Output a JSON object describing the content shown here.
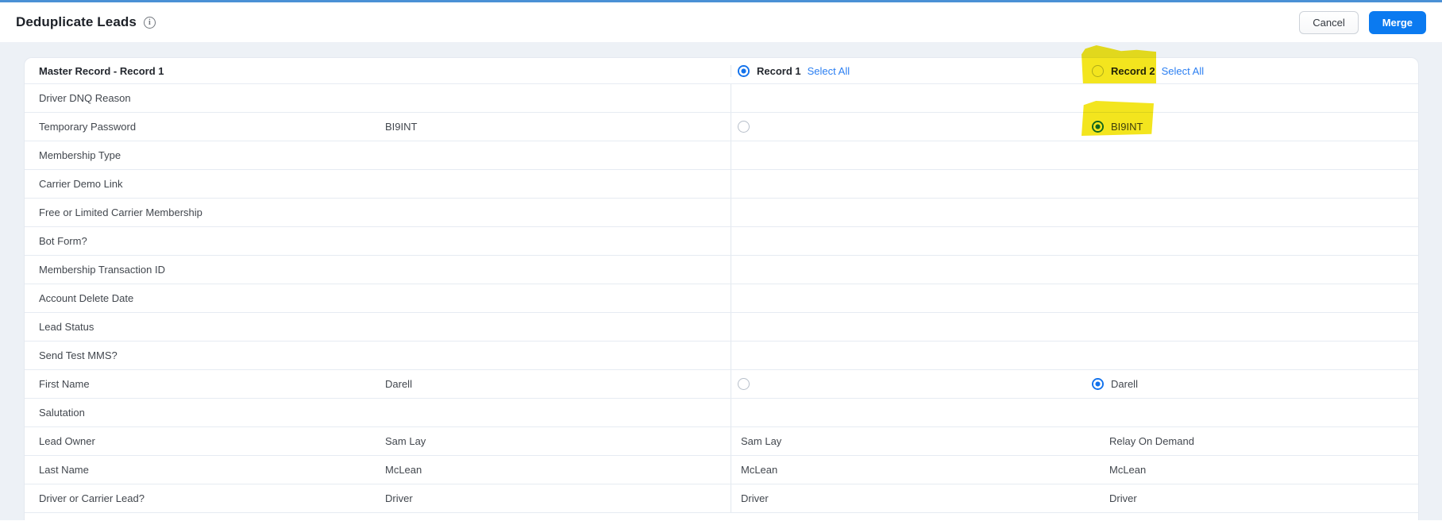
{
  "header": {
    "title": "Deduplicate Leads",
    "cancel_label": "Cancel",
    "merge_label": "Merge"
  },
  "table": {
    "master_header": "Master Record - Record 1",
    "record1_header": {
      "label": "Record 1",
      "select_all": "Select All",
      "radio": "selected"
    },
    "record2_header": {
      "label": "Record 2",
      "select_all": "Select All",
      "radio": "unselected"
    },
    "rows": [
      {
        "label": "Driver DNQ Reason",
        "master": "",
        "r1": {
          "radio": "none",
          "text": ""
        },
        "r2": {
          "radio": "none",
          "text": ""
        }
      },
      {
        "label": "Temporary Password",
        "master": "BI9INT",
        "r1": {
          "radio": "unselected",
          "text": ""
        },
        "r2": {
          "radio": "selected",
          "text": "BI9INT",
          "highlight": true
        }
      },
      {
        "label": "Membership Type",
        "master": "",
        "r1": {
          "radio": "none",
          "text": ""
        },
        "r2": {
          "radio": "none",
          "text": ""
        }
      },
      {
        "label": "Carrier Demo Link",
        "master": "",
        "r1": {
          "radio": "none",
          "text": ""
        },
        "r2": {
          "radio": "none",
          "text": ""
        }
      },
      {
        "label": "Free or Limited Carrier Membership",
        "master": "",
        "r1": {
          "radio": "none",
          "text": ""
        },
        "r2": {
          "radio": "none",
          "text": ""
        }
      },
      {
        "label": "Bot Form?",
        "master": "",
        "r1": {
          "radio": "none",
          "text": ""
        },
        "r2": {
          "radio": "none",
          "text": ""
        }
      },
      {
        "label": "Membership Transaction ID",
        "master": "",
        "r1": {
          "radio": "none",
          "text": ""
        },
        "r2": {
          "radio": "none",
          "text": ""
        }
      },
      {
        "label": "Account Delete Date",
        "master": "",
        "r1": {
          "radio": "none",
          "text": ""
        },
        "r2": {
          "radio": "none",
          "text": ""
        }
      },
      {
        "label": "Lead Status",
        "master": "",
        "r1": {
          "radio": "none",
          "text": ""
        },
        "r2": {
          "radio": "none",
          "text": ""
        }
      },
      {
        "label": "Send Test MMS?",
        "master": "",
        "r1": {
          "radio": "none",
          "text": ""
        },
        "r2": {
          "radio": "none",
          "text": ""
        }
      },
      {
        "label": "First Name",
        "master": "Darell",
        "r1": {
          "radio": "unselected",
          "text": ""
        },
        "r2": {
          "radio": "selected",
          "text": "Darell"
        }
      },
      {
        "label": "Salutation",
        "master": "",
        "r1": {
          "radio": "none",
          "text": ""
        },
        "r2": {
          "radio": "none",
          "text": ""
        }
      },
      {
        "label": "Lead Owner",
        "master": "Sam Lay",
        "r1": {
          "radio": "none",
          "text": "Sam Lay"
        },
        "r2": {
          "radio": "none",
          "text": "Relay On Demand"
        }
      },
      {
        "label": "Last Name",
        "master": "McLean",
        "r1": {
          "radio": "none",
          "text": "McLean"
        },
        "r2": {
          "radio": "none",
          "text": "McLean"
        }
      },
      {
        "label": "Driver or Carrier Lead?",
        "master": "Driver",
        "r1": {
          "radio": "none",
          "text": "Driver"
        },
        "r2": {
          "radio": "none",
          "text": "Driver"
        }
      }
    ]
  },
  "annotations": {
    "highlight_color": "#f2e30a",
    "highlighted": [
      "record2-header",
      "record2-temporary-password-value"
    ]
  },
  "colors": {
    "top_strip": "#4a90d5",
    "merge_button": "#0b7af0",
    "link_blue": "#2b7ff2",
    "radio_selected": "#1272ec",
    "page_background": "#edf1f6",
    "row_divider": "#e6ebf2"
  }
}
